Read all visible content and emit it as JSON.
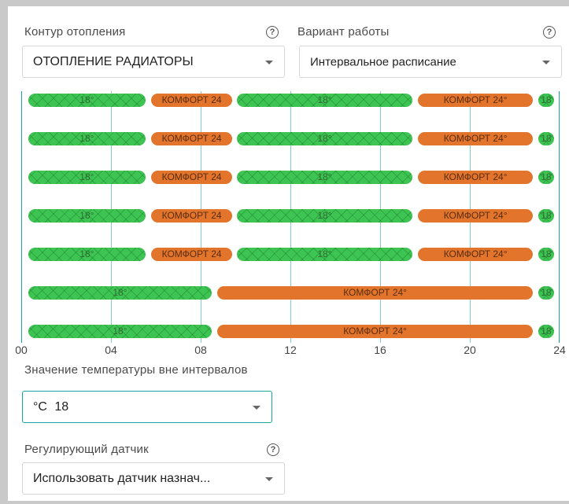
{
  "heating_circuit": {
    "label": "Контур отопления",
    "value": "ОТОПЛЕНИЕ РАДИАТОРЫ"
  },
  "work_mode": {
    "label": "Вариант работы",
    "value": "Интервальное расписание"
  },
  "help_glyph": "?",
  "colors": {
    "accent": "#15a8a0",
    "interval_green": "#3ec452",
    "interval_orange": "#e2752b"
  },
  "schedule": {
    "hours_per_day": 24,
    "ticks": [
      "00",
      "04",
      "08",
      "12",
      "16",
      "20",
      "24"
    ],
    "rows": [
      {
        "segments": [
          {
            "type": "g",
            "label": "18°",
            "start": 0.3,
            "end": 5.55
          },
          {
            "type": "o",
            "label": "КОМФОРТ 24",
            "start": 5.8,
            "end": 9.4
          },
          {
            "type": "g",
            "label": "18°",
            "start": 9.6,
            "end": 17.45
          },
          {
            "type": "o",
            "label": "КОМФОРТ 24°",
            "start": 17.7,
            "end": 22.8
          },
          {
            "type": "g",
            "label": "18",
            "start": 23.05,
            "end": 23.75
          }
        ]
      },
      {
        "segments": [
          {
            "type": "g",
            "label": "18°",
            "start": 0.3,
            "end": 5.55
          },
          {
            "type": "o",
            "label": "КОМФОРТ 24",
            "start": 5.8,
            "end": 9.4
          },
          {
            "type": "g",
            "label": "18°",
            "start": 9.6,
            "end": 17.45
          },
          {
            "type": "o",
            "label": "КОМФОРТ 24°",
            "start": 17.7,
            "end": 22.8
          },
          {
            "type": "g",
            "label": "18",
            "start": 23.05,
            "end": 23.75
          }
        ]
      },
      {
        "segments": [
          {
            "type": "g",
            "label": "18°",
            "start": 0.3,
            "end": 5.55
          },
          {
            "type": "o",
            "label": "КОМФОРТ 24",
            "start": 5.8,
            "end": 9.4
          },
          {
            "type": "g",
            "label": "18°",
            "start": 9.6,
            "end": 17.45
          },
          {
            "type": "o",
            "label": "КОМФОРТ 24°",
            "start": 17.7,
            "end": 22.8
          },
          {
            "type": "g",
            "label": "18",
            "start": 23.05,
            "end": 23.75
          }
        ]
      },
      {
        "segments": [
          {
            "type": "g",
            "label": "18°",
            "start": 0.3,
            "end": 5.55
          },
          {
            "type": "o",
            "label": "КОМФОРТ 24",
            "start": 5.8,
            "end": 9.4
          },
          {
            "type": "g",
            "label": "18°",
            "start": 9.6,
            "end": 17.45
          },
          {
            "type": "o",
            "label": "КОМФОРТ 24°",
            "start": 17.7,
            "end": 22.8
          },
          {
            "type": "g",
            "label": "18",
            "start": 23.05,
            "end": 23.75
          }
        ]
      },
      {
        "segments": [
          {
            "type": "g",
            "label": "18°",
            "start": 0.3,
            "end": 5.55
          },
          {
            "type": "o",
            "label": "КОМФОРТ 24",
            "start": 5.8,
            "end": 9.4
          },
          {
            "type": "g",
            "label": "18°",
            "start": 9.6,
            "end": 17.45
          },
          {
            "type": "o",
            "label": "КОМФОРТ 24°",
            "start": 17.7,
            "end": 22.8
          },
          {
            "type": "g",
            "label": "18",
            "start": 23.05,
            "end": 23.75
          }
        ]
      },
      {
        "segments": [
          {
            "type": "g",
            "label": "18°",
            "start": 0.3,
            "end": 8.5
          },
          {
            "type": "o",
            "label": "КОМФОРТ 24°",
            "start": 8.75,
            "end": 22.8
          },
          {
            "type": "g",
            "label": "18",
            "start": 23.05,
            "end": 23.75
          }
        ]
      },
      {
        "segments": [
          {
            "type": "g",
            "label": "18°",
            "start": 0.3,
            "end": 8.5
          },
          {
            "type": "o",
            "label": "КОМФОРТ 24°",
            "start": 8.75,
            "end": 22.8
          },
          {
            "type": "g",
            "label": "18",
            "start": 23.05,
            "end": 23.75
          }
        ]
      }
    ]
  },
  "outside_temp": {
    "label": "Значение температуры вне интервалов",
    "unit": "°C",
    "value": "18"
  },
  "sensor": {
    "label": "Регулирующий датчик",
    "value": "Использовать датчик назнач..."
  }
}
